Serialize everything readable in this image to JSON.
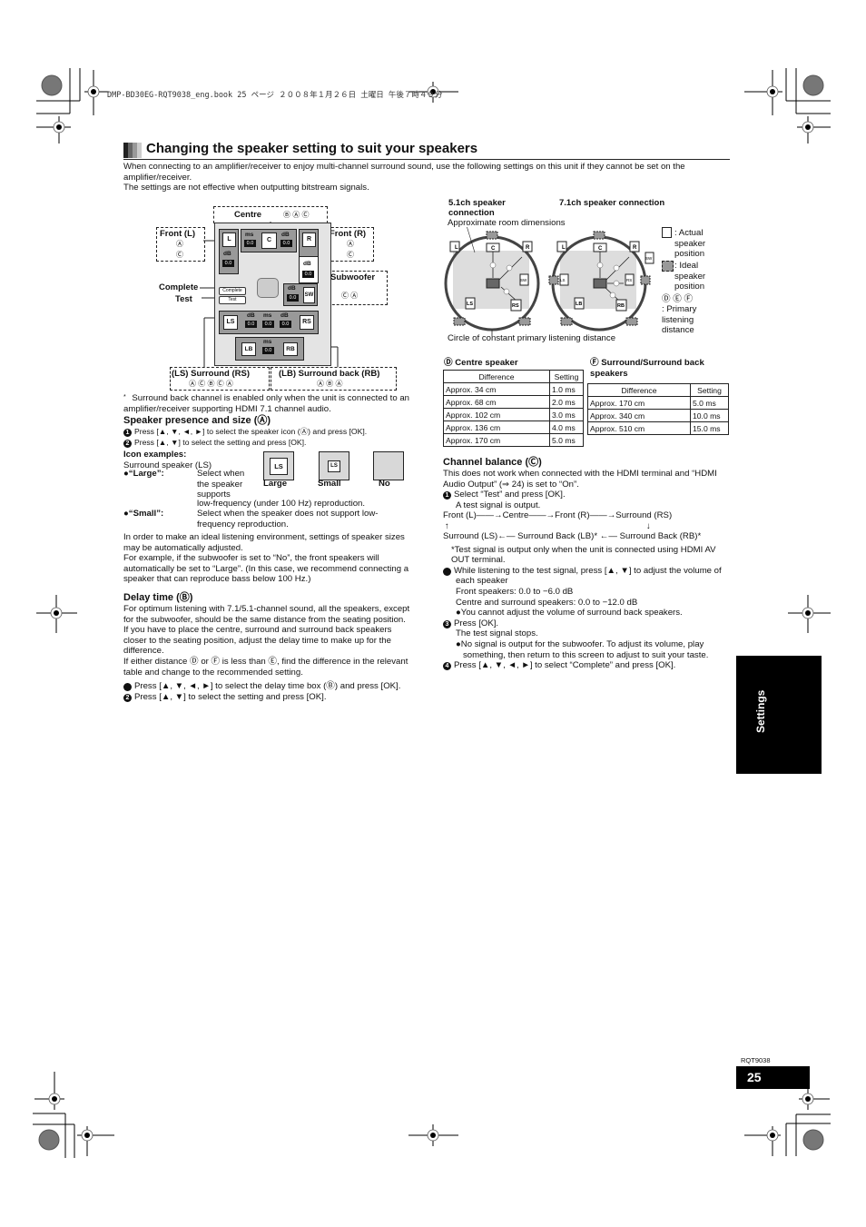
{
  "header_line": "DMP-BD30EG-RQT9038_eng.book  25 ページ  ２００８年１月２６日  土曜日  午後７時４９分",
  "title": "Changing the speaker setting to suit your speakers",
  "intro": [
    "When connecting to an amplifier/receiver to enjoy multi-channel surround sound, use the following settings on this unit if they cannot be set on the amplifier/receiver.",
    "The settings are not effective when outputting bitstream signals."
  ],
  "diagram": {
    "centre_label": "Centre",
    "centre_marks": "Ⓑ Ⓐ Ⓒ",
    "front_l_label": "Front (L)",
    "front_l_marks": [
      "Ⓐ",
      "Ⓒ"
    ],
    "front_r_label": "Front (R)",
    "front_r_marks": [
      "Ⓐ",
      "Ⓒ"
    ],
    "subwoofer_label": "Subwoofer",
    "subwoofer_marks": "Ⓒ Ⓐ",
    "complete_label": "Complete",
    "test_label": "Test",
    "complete_button": "Complete",
    "test_button": "Test",
    "surround_label": "(LS)  Surround   (RS)",
    "surround_marks": "Ⓐ Ⓒ Ⓑ Ⓒ Ⓐ",
    "surround_back_label": "(LB) Surround back (RB)",
    "surround_back_marks": "Ⓐ Ⓑ Ⓐ",
    "asterisk": "*",
    "ms": "ms",
    "db": "dB",
    "value": "0.0",
    "speakers": {
      "L": "L",
      "C": "C",
      "R": "R",
      "SW": "SW",
      "LS": "LS",
      "RS": "RS",
      "LB": "LB",
      "RB": "RB"
    }
  },
  "footnote": "Surround back channel is enabled only when the unit is connected to an amplifier/receiver supporting HDMI 7.1 channel audio.",
  "speaker_presence": {
    "heading": "Speaker presence and size (Ⓐ)",
    "step1": "Press [▲, ▼, ◄, ►] to select the speaker icon (Ⓐ) and press [OK].",
    "step2": "Press [▲, ▼] to select the setting and press [OK].",
    "icon_examples_heading": "Icon examples:",
    "icon_examples_sub": "Surround speaker (LS)",
    "icons": [
      {
        "label": "Large",
        "glyph": "LS"
      },
      {
        "label": "Small",
        "glyph": "LS"
      },
      {
        "label": "No",
        "glyph": ""
      }
    ],
    "large_term": "“Large”:",
    "large_desc_a": "Select when the speaker supports",
    "large_desc_b": "low-frequency (under 100 Hz) reproduction.",
    "small_term": "“Small”:",
    "small_desc": "Select when the speaker does not support low-frequency reproduction.",
    "para1": "In order to make an ideal listening environment, settings of speaker sizes may be automatically adjusted.",
    "para2": "For example, if the subwoofer is set to “No”, the front speakers will automatically be set to “Large”. (In this case, we recommend connecting a speaker that can reproduce bass below 100 Hz.)"
  },
  "delay_time": {
    "heading": "Delay time (Ⓑ)",
    "para1": "For optimum listening with 7.1/5.1-channel sound, all the speakers, except for the subwoofer, should be the same distance from the seating position.",
    "para2": "If you have to place the centre, surround and surround back speakers closer to the seating position, adjust the delay time to make up for the difference.",
    "para3": "If either distance Ⓓ or Ⓕ is less than Ⓔ, find the difference in the relevant table and change to the recommended setting.",
    "step1": "Press [▲, ▼, ◄, ►] to select the delay time box (Ⓑ) and press [OK].",
    "step2": "Press [▲, ▼] to select the setting and press [OK]."
  },
  "room_diagram": {
    "title_51": "5.1ch speaker connection",
    "title_71": "7.1ch speaker connection",
    "room_dims": "Approximate room dimensions",
    "circle_caption": "Circle of constant primary listening distance",
    "legend_actual": ": Actual speaker position",
    "legend_ideal": ": Ideal speaker position",
    "legend_def": "Ⓓ Ⓔ Ⓕ",
    "legend_primary": ": Primary listening distance"
  },
  "centre_table": {
    "heading": "Ⓓ Centre speaker",
    "headers": [
      "Difference",
      "Setting"
    ],
    "rows": [
      [
        "Approx. 34 cm",
        "1.0 ms"
      ],
      [
        "Approx. 68 cm",
        "2.0 ms"
      ],
      [
        "Approx. 102 cm",
        "3.0 ms"
      ],
      [
        "Approx. 136 cm",
        "4.0 ms"
      ],
      [
        "Approx. 170 cm",
        "5.0 ms"
      ]
    ]
  },
  "surround_table": {
    "heading": "Ⓕ Surround/Surround back speakers",
    "headers": [
      "Difference",
      "Setting"
    ],
    "rows": [
      [
        "Approx. 170 cm",
        "5.0 ms"
      ],
      [
        "Approx. 340 cm",
        "10.0 ms"
      ],
      [
        "Approx. 510 cm",
        "15.0 ms"
      ]
    ]
  },
  "channel_balance": {
    "heading": "Channel balance (Ⓒ)",
    "para": "This does not work when connected with the HDMI terminal and “HDMI Audio Output” (⇒ 24) is set to “On”.",
    "step1": "Select “Test” and press [OK].",
    "step1_sub": "A test signal is output.",
    "flow_top": "Front (L)——→Centre——→Front (R)——→Surround (RS)",
    "flow_up": "↑",
    "flow_down": "↓",
    "flow_bottom": "Surround (LS)←— Surround Back (LB)* ←— Surround Back (RB)*",
    "flow_note": "*Test signal is output only when the unit is connected using HDMI AV OUT terminal.",
    "step2": "While listening to the test signal, press [▲, ▼] to adjust the volume of each speaker",
    "step2_front": "Front speakers: 0.0 to −6.0 dB",
    "step2_centre": "Centre and surround speakers: 0.0 to −12.0 dB",
    "step2_bullet": "You cannot adjust the volume of surround back speakers.",
    "step3": "Press [OK].",
    "step3_sub": "The test signal stops.",
    "step3_bullet": "No signal is output for the subwoofer. To adjust its volume, play something, then return to this screen to adjust to suit your taste.",
    "step4": "Press [▲, ▼, ◄, ►] to select “Complete” and press [OK]."
  },
  "side_tab": "Settings",
  "doc_code": "RQT9038",
  "page_number": "25",
  "nums": {
    "n1": "1",
    "n2": "2",
    "n3": "3",
    "n4": "4"
  },
  "bullet": "●"
}
